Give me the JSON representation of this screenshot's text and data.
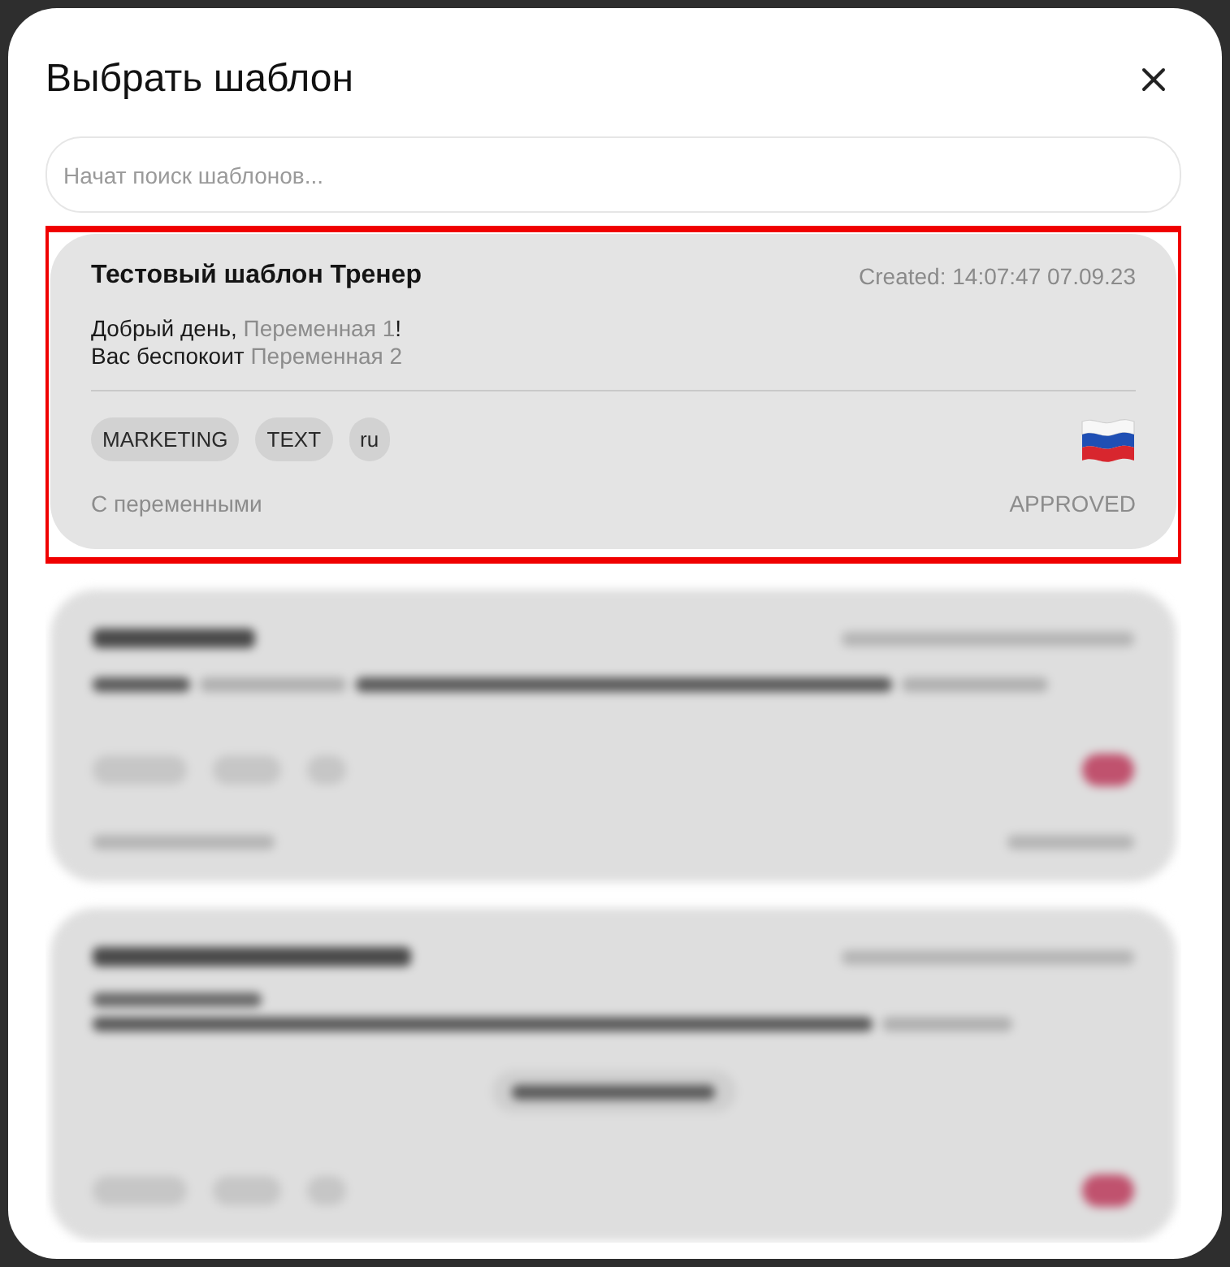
{
  "dialog": {
    "title": "Выбрать шаблон",
    "search": {
      "placeholder": "Начат поиск шаблонов..."
    },
    "templates": [
      {
        "kind": "full",
        "highlighted": true,
        "name": "Тестовый шаблон Тренер",
        "created": "Created: 14:07:47 07.09.23",
        "body": [
          [
            {
              "text": "Добрый день, ",
              "variable": false
            },
            {
              "text": "Переменная 1",
              "variable": true
            },
            {
              "text": "!",
              "variable": false
            }
          ],
          [
            {
              "text": "Вас беспокоит ",
              "variable": false
            },
            {
              "text": "Переменная 2",
              "variable": true
            }
          ]
        ],
        "tags": [
          "MARKETING",
          "TEXT",
          "ru"
        ],
        "note": "С переменными",
        "status": "APPROVED"
      },
      {
        "kind": "blurred",
        "highlighted": false,
        "button": false
      },
      {
        "kind": "blurred",
        "highlighted": false,
        "button": true
      }
    ]
  }
}
